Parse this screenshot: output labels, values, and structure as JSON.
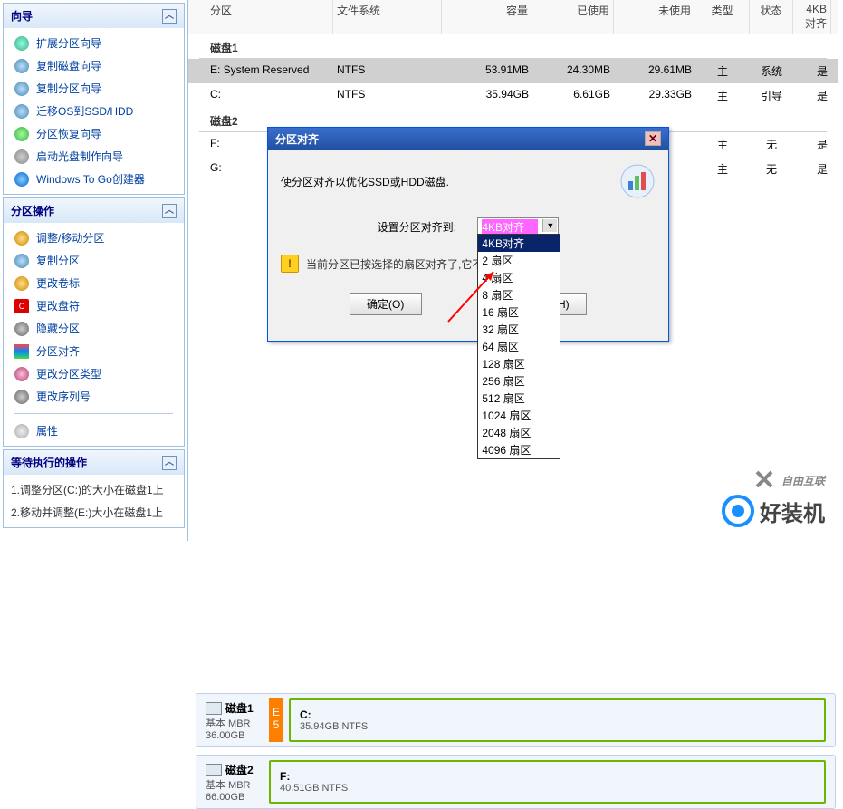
{
  "sidebar": {
    "wizard_panel": {
      "title": "向导",
      "items": [
        {
          "label": "扩展分区向导"
        },
        {
          "label": "复制磁盘向导"
        },
        {
          "label": "复制分区向导"
        },
        {
          "label": "迁移OS到SSD/HDD"
        },
        {
          "label": "分区恢复向导"
        },
        {
          "label": "启动光盘制作向导"
        },
        {
          "label": "Windows To Go创建器"
        }
      ]
    },
    "ops_panel": {
      "title": "分区操作",
      "items": [
        {
          "label": "调整/移动分区"
        },
        {
          "label": "复制分区"
        },
        {
          "label": "更改卷标"
        },
        {
          "label": "更改盘符"
        },
        {
          "label": "隐藏分区"
        },
        {
          "label": "分区对齐"
        },
        {
          "label": "更改分区类型"
        },
        {
          "label": "更改序列号"
        },
        {
          "label": "属性"
        }
      ]
    },
    "pending_panel": {
      "title": "等待执行的操作",
      "items": [
        "1.调整分区(C:)的大小在磁盘1上",
        "2.移动并调整(E:)大小在磁盘1上"
      ]
    }
  },
  "columns": {
    "partition": "分区",
    "filesystem": "文件系统",
    "capacity": "容量",
    "used": "已使用",
    "free": "未使用",
    "type": "类型",
    "status": "状态",
    "align4kb": "4KB对齐"
  },
  "disk_groups": {
    "disk1_label": "磁盘1",
    "disk2_label": "磁盘2"
  },
  "rows": {
    "r1": {
      "partition": "E: System Reserved",
      "fs": "NTFS",
      "capacity": "53.91MB",
      "used": "24.30MB",
      "free": "29.61MB",
      "type": "主",
      "status": "系统",
      "align": "是"
    },
    "r2": {
      "partition": "C:",
      "fs": "NTFS",
      "capacity": "35.94GB",
      "used": "6.61GB",
      "free": "29.33GB",
      "type": "主",
      "status": "引导",
      "align": "是"
    },
    "r3": {
      "partition": "F:",
      "fs": "",
      "capacity": "",
      "used": "",
      "free": "",
      "type": "主",
      "status": "无",
      "align": "是"
    },
    "r4": {
      "partition": "G:",
      "fs": "",
      "capacity": "",
      "used": "",
      "free": "",
      "type": "主",
      "status": "无",
      "align": "是"
    }
  },
  "dialog": {
    "title": "分区对齐",
    "message": "使分区对齐以优化SSD或HDD磁盘.",
    "setting_label": "设置分区对齐到:",
    "dropdown_selected": "4KB对齐",
    "dropdown_options": [
      "4KB对齐",
      "2 扇区",
      "4 扇区",
      "8 扇区",
      "16 扇区",
      "32 扇区",
      "64 扇区",
      "128 扇区",
      "256 扇区",
      "512 扇区",
      "1024 扇区",
      "2048 扇区",
      "4096 扇区"
    ],
    "warning": "当前分区已按选择的扇区对齐了,它不需要被再次",
    "btn_ok": "确定(O)",
    "btn_help": "帮助(H)"
  },
  "disk_summary": {
    "d1": {
      "name": "磁盘1",
      "info1": "基本 MBR",
      "info2": "36.00GB",
      "e_label1": "E",
      "e_label2": "5",
      "part_name": "C:",
      "part_info": "35.94GB NTFS"
    },
    "d2": {
      "name": "磁盘2",
      "info1": "基本 MBR",
      "info2": "66.00GB",
      "part_name": "F:",
      "part_info": "40.51GB NTFS"
    }
  },
  "watermarks": {
    "w1": "自由互联",
    "w2": "好装机"
  },
  "help_btn_offset": "帮助(H)"
}
